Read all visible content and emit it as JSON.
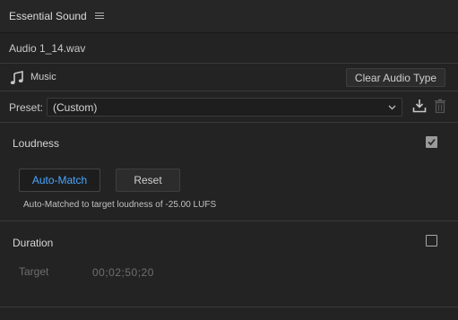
{
  "panel": {
    "title": "Essential Sound"
  },
  "file": {
    "name": "Audio 1_14.wav"
  },
  "audio_type": {
    "label": "Music",
    "icon": "music-note-icon",
    "clear_label": "Clear Audio Type"
  },
  "preset": {
    "label": "Preset:",
    "value": "(Custom)"
  },
  "loudness": {
    "title": "Loudness",
    "checked": true,
    "auto_match_label": "Auto-Match",
    "reset_label": "Reset",
    "note": "Auto-Matched to target loudness of -25.00 LUFS"
  },
  "duration": {
    "title": "Duration",
    "checked": false,
    "target_label": "Target",
    "target_value": "00;02;50;20"
  },
  "colors": {
    "background": "#232323",
    "accent": "#4aa6ff",
    "text": "#cfcfcf"
  }
}
